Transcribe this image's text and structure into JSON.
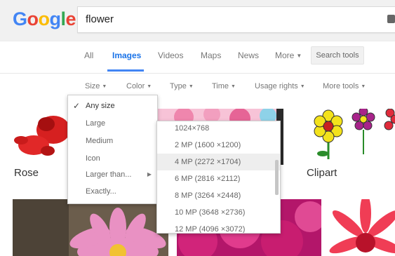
{
  "header": {
    "logo_letters": [
      {
        "ch": "G",
        "color": "#4285f4"
      },
      {
        "ch": "o",
        "color": "#ea4335"
      },
      {
        "ch": "o",
        "color": "#fbbc05"
      },
      {
        "ch": "g",
        "color": "#4285f4"
      },
      {
        "ch": "l",
        "color": "#34a853"
      },
      {
        "ch": "e",
        "color": "#ea4335"
      }
    ],
    "search_value": "flower"
  },
  "tabs": {
    "all": "All",
    "images": "Images",
    "videos": "Videos",
    "maps": "Maps",
    "news": "News",
    "more": "More",
    "search_tools": "Search tools"
  },
  "filters": {
    "size": "Size",
    "color": "Color",
    "type": "Type",
    "time": "Time",
    "usage_rights": "Usage rights",
    "more_tools": "More tools"
  },
  "size_menu": {
    "items": [
      "Any size",
      "Large",
      "Medium",
      "Icon",
      "Larger than...",
      "Exactly..."
    ],
    "selected": "Any size"
  },
  "larger_than_menu": {
    "items": [
      "1024×768",
      "2 MP (1600 ×1200)",
      "4 MP (2272 ×1704)",
      "6 MP (2816 ×2112)",
      "8 MP (3264 ×2448)",
      "10 MP (3648 ×2736)",
      "12 MP (4096 ×3072)"
    ],
    "highlighted": "4 MP (2272 ×1704)"
  },
  "results": {
    "captions": {
      "rose": "Rose",
      "clipart": "Clipart"
    }
  },
  "colors": {
    "accent": "#4285f4",
    "rose_red": "#d62020",
    "pink": "#e84a8a",
    "magenta": "#d1247a"
  }
}
